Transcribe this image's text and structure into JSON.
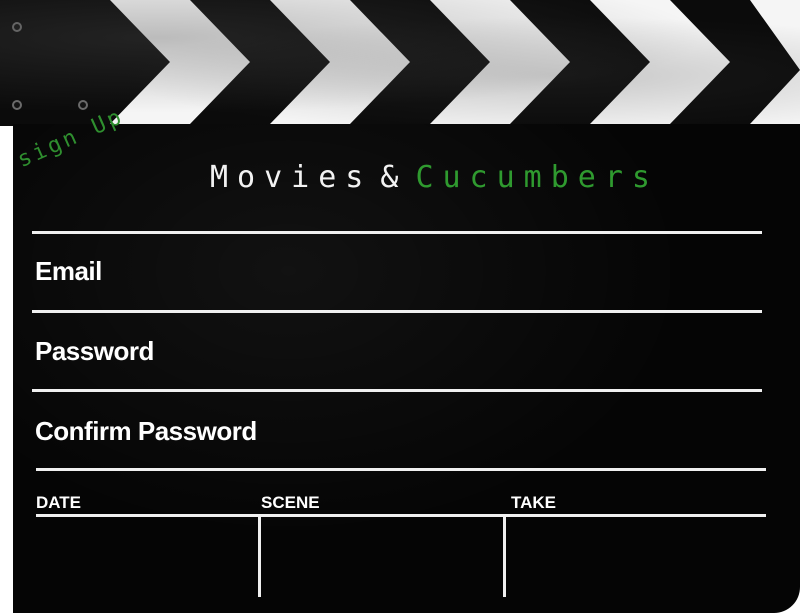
{
  "header": {
    "sign_up": "sign Up",
    "title_part1": "Movies",
    "title_amp": "&",
    "title_part2": "Cucumbers"
  },
  "form": {
    "email_label": "Email",
    "password_label": "Password",
    "confirm_password_label": "Confirm Password",
    "email_value": "",
    "password_value": "",
    "confirm_password_value": ""
  },
  "slate_columns": {
    "date": "DATE",
    "scene": "SCENE",
    "take": "TAKE"
  },
  "colors": {
    "accent_green": "#2f9a2f",
    "chalk_white": "#f2f2f2",
    "slate_black": "#050505"
  },
  "icons": {
    "bolts": "hinge-bolt-icon"
  }
}
